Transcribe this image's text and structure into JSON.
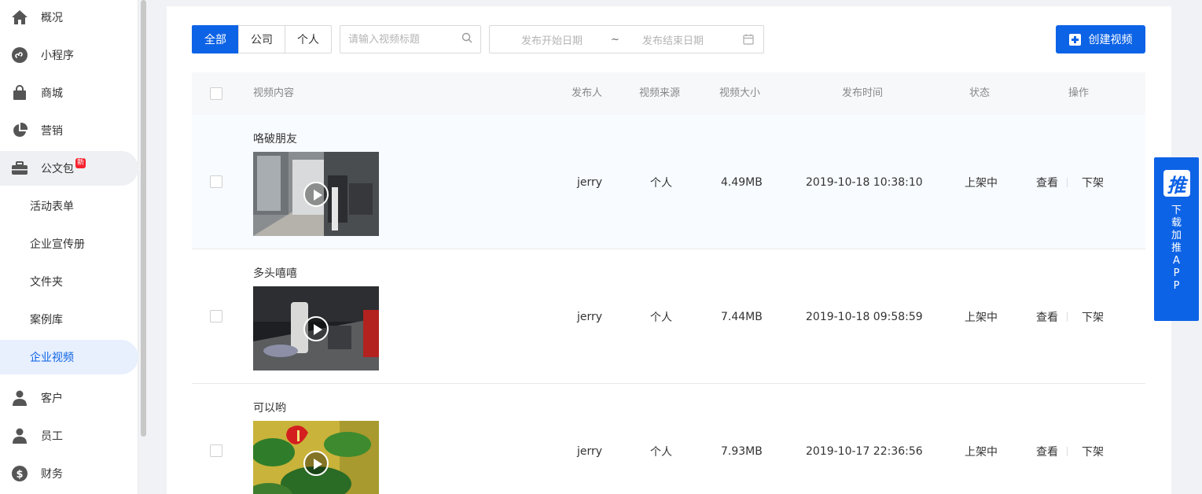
{
  "sidebar": {
    "items": [
      {
        "label": "概况",
        "icon": "home-icon"
      },
      {
        "label": "小程序",
        "icon": "mini-program-icon"
      },
      {
        "label": "商城",
        "icon": "shopping-bag-icon"
      },
      {
        "label": "营销",
        "icon": "pie-chart-icon"
      },
      {
        "label": "公文包",
        "icon": "briefcase-icon",
        "badge": "新"
      },
      {
        "label": "活动表单"
      },
      {
        "label": "企业宣传册"
      },
      {
        "label": "文件夹"
      },
      {
        "label": "案例库"
      },
      {
        "label": "企业视频"
      },
      {
        "label": "客户",
        "icon": "customer-icon"
      },
      {
        "label": "员工",
        "icon": "employee-icon"
      },
      {
        "label": "财务",
        "icon": "dollar-icon"
      }
    ]
  },
  "filters": {
    "tabs": [
      "全部",
      "公司",
      "个人"
    ],
    "search_placeholder": "请输入视频标题",
    "date_start_placeholder": "发布开始日期",
    "date_separator": "~",
    "date_end_placeholder": "发布结束日期"
  },
  "create_button": "创建视频",
  "table": {
    "headers": [
      "视频内容",
      "发布人",
      "视频来源",
      "视频大小",
      "发布时间",
      "状态",
      "操作"
    ],
    "rows": [
      {
        "title": "咯破朋友",
        "publisher": "jerry",
        "source": "个人",
        "size": "4.49MB",
        "time": "2019-10-18 10:38:10",
        "status": "上架中",
        "action_view": "查看",
        "action_off": "下架"
      },
      {
        "title": "多头嘻嘻",
        "publisher": "jerry",
        "source": "个人",
        "size": "7.44MB",
        "time": "2019-10-18 09:58:59",
        "status": "上架中",
        "action_view": "查看",
        "action_off": "下架"
      },
      {
        "title": "可以哟",
        "publisher": "jerry",
        "source": "个人",
        "size": "7.93MB",
        "time": "2019-10-17 22:36:56",
        "status": "上架中",
        "action_view": "查看",
        "action_off": "下架"
      }
    ]
  },
  "app_tab": {
    "logo": "推",
    "text": "下载加推APP"
  },
  "colors": {
    "primary": "#0d63e6",
    "link": "#1a66d2"
  }
}
